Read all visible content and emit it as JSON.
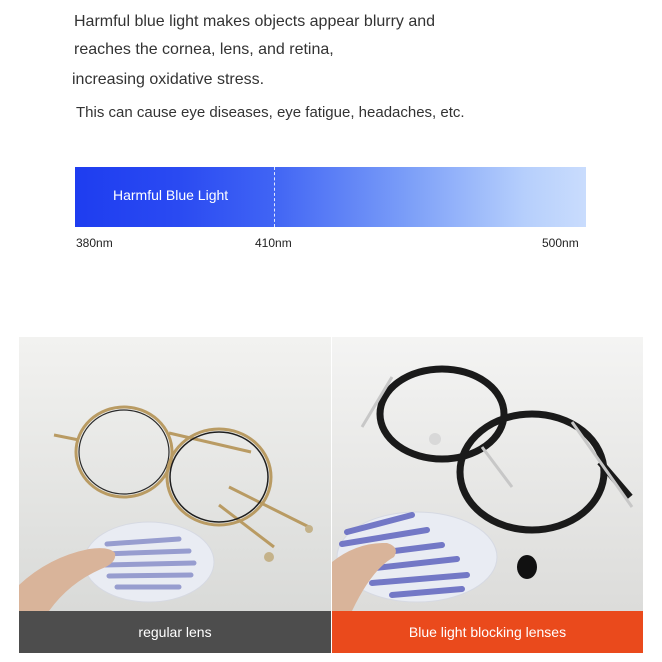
{
  "intro": {
    "line1": "Harmful blue light makes objects appear blurry and",
    "line2": "reaches the cornea, lens, and retina,",
    "line3": "increasing oxidative stress.",
    "line4": "This can cause eye diseases, eye fatigue, headaches, etc."
  },
  "spectrum": {
    "band_label": "Harmful Blue Light",
    "ticks": [
      "380nm",
      "410nm",
      "500nm"
    ],
    "colors": {
      "start": "#1e3df0",
      "end": "#c9dcfd"
    }
  },
  "comparison": {
    "left_caption": "regular lens",
    "right_caption": "Blue light blocking lenses",
    "colors": {
      "left_caption_bg": "#4d4d4d",
      "right_caption_bg": "#ea4a1c"
    }
  }
}
